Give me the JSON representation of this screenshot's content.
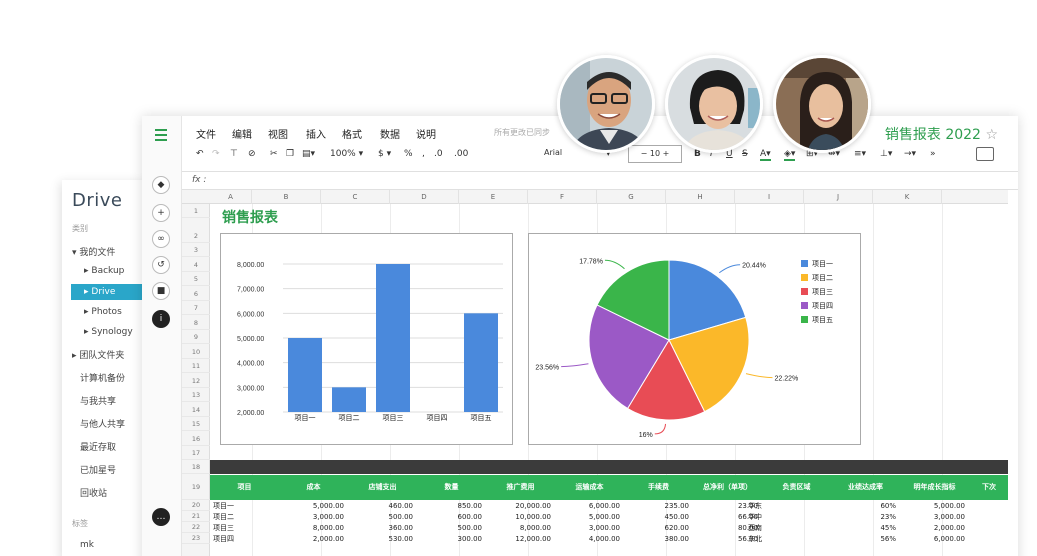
{
  "drive": {
    "logo": "Drive",
    "section_category": "类别",
    "my_files": "我的文件",
    "sub_items": [
      "Backup",
      "Drive",
      "Photos",
      "Synology"
    ],
    "nav": [
      "团队文件夹",
      "计算机备份",
      "与我共享",
      "与他人共享",
      "最近存取",
      "已加星号",
      "回收站"
    ],
    "section_tags": "标签",
    "tag": "mk"
  },
  "sheet": {
    "menu": [
      "文件",
      "编辑",
      "视图",
      "插入",
      "格式",
      "数据",
      "说明"
    ],
    "status": "所有更改已同步",
    "title": "销售报表 2022",
    "zoom": "100%",
    "currency": "$",
    "percent": "%",
    "font": "Arial",
    "font_size": "10",
    "fx": "fx",
    "heading": "销售报表",
    "columns": [
      "A",
      "B",
      "C",
      "D",
      "E",
      "F",
      "G",
      "H",
      "I",
      "J",
      "K"
    ],
    "rows": [
      "1",
      "2",
      "3",
      "4",
      "5",
      "6",
      "7",
      "8",
      "9",
      "10",
      "11",
      "12",
      "13",
      "14",
      "15",
      "16",
      "17",
      "18",
      "19",
      "20",
      "21",
      "22",
      "23"
    ]
  },
  "chart_data": [
    {
      "type": "bar",
      "categories": [
        "项目一",
        "项目二",
        "项目三",
        "项目四",
        "项目五"
      ],
      "values": [
        5000,
        3000,
        8000,
        2000,
        6000
      ],
      "yticks": [
        "8,000.00",
        "7,000.00",
        "6,000.00",
        "5,000.00",
        "4,000.00",
        "3,000.00",
        "2,000.00"
      ],
      "ylim": [
        2000,
        8000
      ],
      "color": "#4a89dc"
    },
    {
      "type": "pie",
      "labels": [
        "项目一",
        "项目二",
        "项目三",
        "项目四",
        "项目五"
      ],
      "values": [
        20.44,
        22.22,
        16,
        23.56,
        17.78
      ],
      "value_labels": [
        "20.44%",
        "22.22%",
        "16%",
        "23.56%",
        "17.78%"
      ],
      "colors": [
        "#4a89dc",
        "#fbb829",
        "#e84c55",
        "#9b59c6",
        "#3ab54a"
      ]
    }
  ],
  "table": {
    "headers": [
      "项目",
      "成本",
      "店铺支出",
      "数量",
      "推广费用",
      "运输成本",
      "手续费",
      "总净利（单项）",
      "负责区域",
      "业绩达成率",
      "明年成长指标",
      "下次"
    ],
    "rows": [
      [
        "项目一",
        "5,000.00",
        "460.00",
        "850.00",
        "20,000.00",
        "6,000.00",
        "235.00",
        "23.00",
        "华东",
        "60%",
        "5,000.00"
      ],
      [
        "项目二",
        "3,000.00",
        "500.00",
        "600.00",
        "10,000.00",
        "5,000.00",
        "450.00",
        "66.00",
        "华中",
        "23%",
        "3,000.00"
      ],
      [
        "项目三",
        "8,000.00",
        "360.00",
        "500.00",
        "8,000.00",
        "3,000.00",
        "620.00",
        "80.00",
        "西南",
        "45%",
        "2,000.00"
      ],
      [
        "项目四",
        "2,000.00",
        "530.00",
        "300.00",
        "12,000.00",
        "4,000.00",
        "380.00",
        "56.00",
        "东北",
        "56%",
        "6,000.00"
      ]
    ]
  }
}
